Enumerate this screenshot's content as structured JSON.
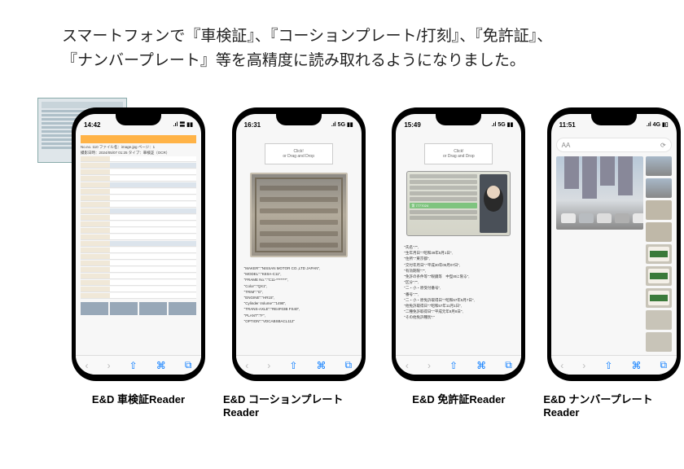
{
  "heading_line1": "スマートフォンで『車検証』、『コーションプレート/打刻』、『免許証』、",
  "heading_line2": "『ナンバープレート』等を高精度に読み取れるようになりました。",
  "phones": [
    {
      "time": "14:42",
      "signal": ".ıl 〓 ▮▮",
      "caption": "E&D 車検証Reader",
      "file_info": "No.no. 110  ファイル名：image.jpg  ページ：1",
      "date_info": "撮影日時：2024/05/07 01:25  タイプ：車検証（OCR）"
    },
    {
      "time": "16:31",
      "signal": ".ıl 5G ▮▮",
      "caption": "E&D コーションプレートReader",
      "click_top": "Click!",
      "click_sub": "or Drag and Drop",
      "plate_maker": "NISSAN MOTOR CO.,LTD JAPAN",
      "out": [
        "\"MAKER\":\"NISSAN MOTOR CO.,LTD JAPAN\",",
        "\"MODEL\":\"KE0A-C11\",",
        "\"FRAME No.\":\"C11-*******\",",
        "\"Color\":\"QX1\",",
        "\"TRIM\":\"G\",",
        "\"ENGINE\":\"HR15\",",
        "\"Cylinder Volume\":\"1498\",",
        "\"TRANS-AXLE\":\"RE4F03B FS40\",",
        "\"PLANT\":\"F\",",
        "\"OPTION\":\"VDCABSBACL112\""
      ]
    },
    {
      "time": "15:49",
      "signal": ".ıl 5G ▮▮",
      "caption": "E&D 免許証Reader",
      "click_top": "Click!",
      "click_sub": "or Drag and Drop",
      "lic_num": "第 7777024",
      "out": [
        "\"氏名\":\"\",",
        "\"生年月日\":\"昭和39年5月1日\",",
        "\"住所\":\"東京都\",",
        "\"交付年月日\":\"平成30年05月07日\",",
        "\"有効期限\":\"\",",
        "\"免許の条件等\":\"眼鏡等　中型8tに限る\",",
        "\"区分\":\"\",",
        "\"二・小・原受付番号\",",
        "\"番号\":\"\",",
        "\"二・小・原免許取得日\":\"昭和57年5月7日\",",
        "\"他免許取得日\":\"昭和57年11月1日\",",
        "\"二種免許取得日\":\"平成元年8月8日\",",
        "\"その他免許種別\":\""
      ]
    },
    {
      "time": "11:51",
      "signal": ".ıl 4G ▮▯",
      "caption": "E&D ナンバープレートReader"
    }
  ],
  "nav_chars": {
    "back": "‹",
    "fwd": "›",
    "share": "⇧",
    "book": "⌘",
    "tabs": "⧉"
  }
}
